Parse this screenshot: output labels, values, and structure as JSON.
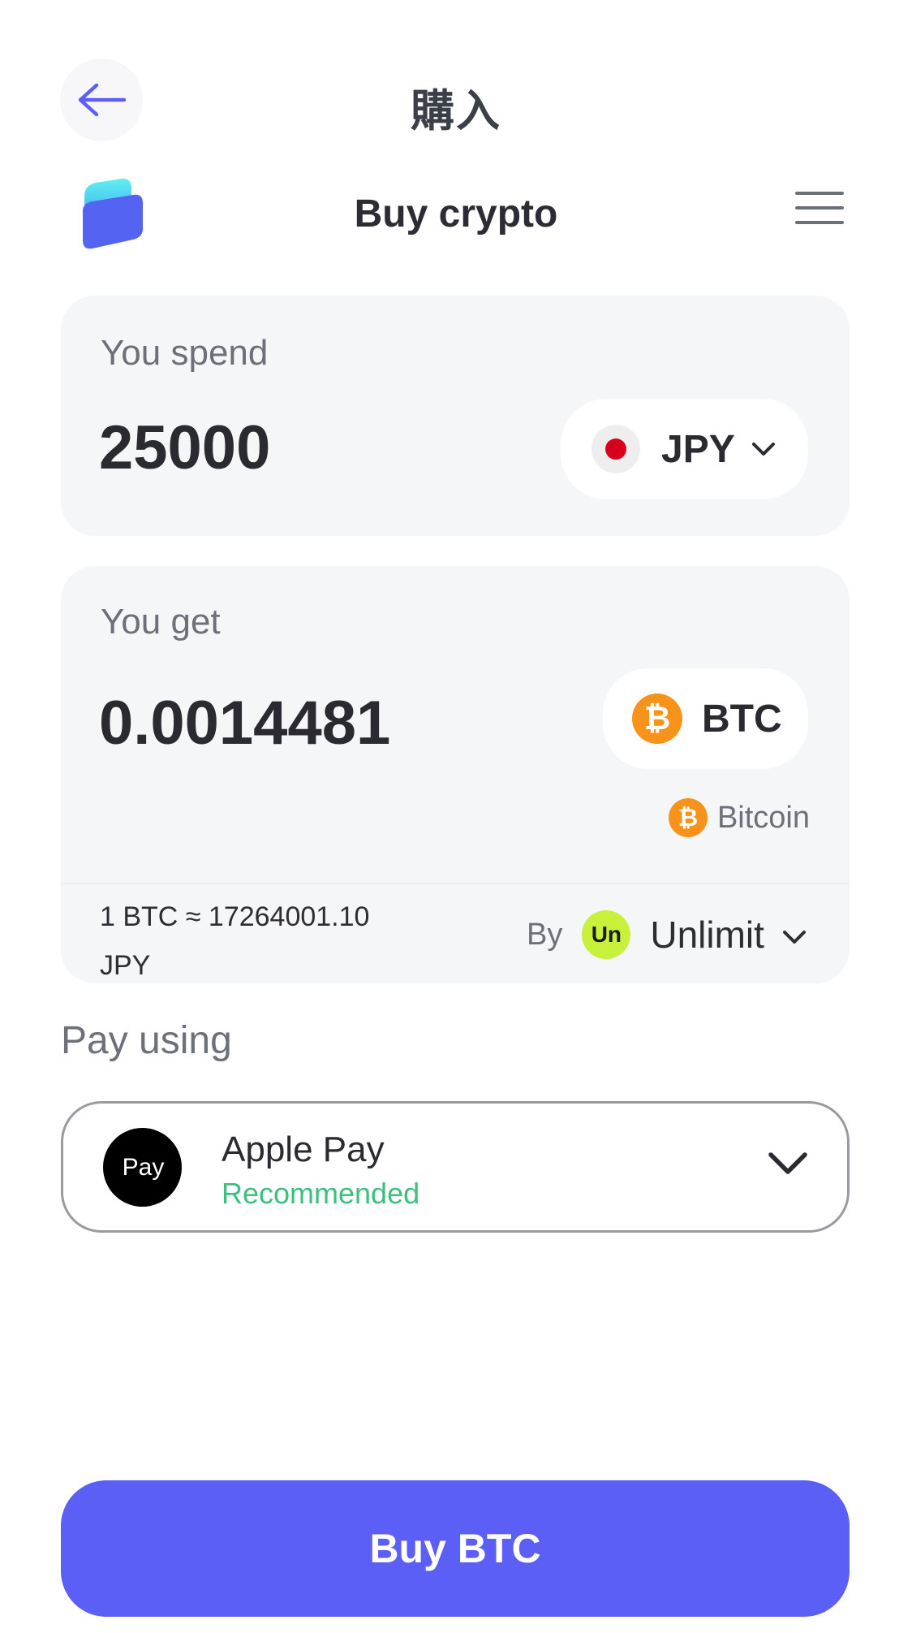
{
  "header": {
    "title": "購入"
  },
  "widget": {
    "title": "Buy crypto"
  },
  "spend": {
    "label": "You spend",
    "amount": "25000",
    "currency": "JPY",
    "flag": "japan-flag"
  },
  "get": {
    "label": "You get",
    "amount": "0.0014481",
    "currency": "BTC",
    "network": "Bitcoin",
    "rate": "1 BTC ≈ 17264001.10 JPY",
    "by_label": "By",
    "provider": "Unlimit",
    "provider_logo_text": "Un"
  },
  "payment": {
    "label": "Pay using",
    "method": "Apple Pay",
    "badge": "Recommended",
    "logo_text": "Pay"
  },
  "cta": {
    "label": "Buy BTC"
  },
  "colors": {
    "accent": "#5c5ff5",
    "recommended": "#3dbf7d",
    "bitcoin": "#f7931a",
    "unlimit": "#c7f13a"
  }
}
